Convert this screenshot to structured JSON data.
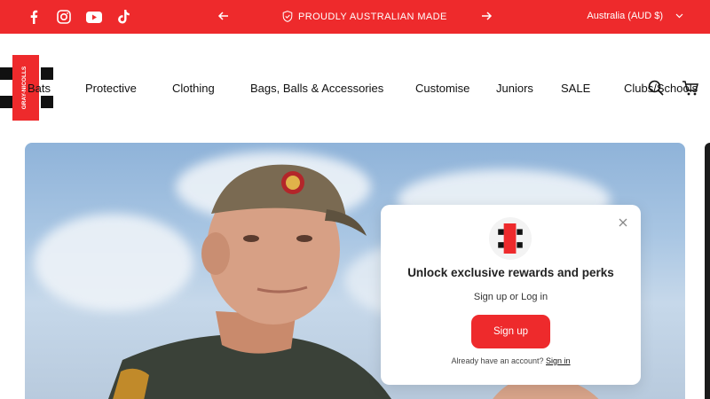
{
  "colors": {
    "accent": "#ee2a2c",
    "announce_text": "#ffffff"
  },
  "announcement": {
    "social_icons": [
      "facebook-icon",
      "instagram-icon",
      "youtube-icon",
      "tiktok-icon"
    ],
    "message": "PROUDLY AUSTRALIAN MADE",
    "locale": "Australia (AUD $)"
  },
  "brand": {
    "logo_text": "GRAY-NICOLLS"
  },
  "nav": {
    "items": [
      "Bats",
      "Protective",
      "Clothing",
      "Bags, Balls & Accessories",
      "Customise",
      "Juniors",
      "SALE",
      "Clubs/Schools"
    ]
  },
  "header_icons": [
    "search-icon",
    "cart-icon"
  ],
  "popup": {
    "headline": "Unlock exclusive rewards and perks",
    "subtext": "Sign up or Log in",
    "button": "Sign up",
    "already_text": "Already have an account?",
    "sign_in_link": "Sign in"
  }
}
